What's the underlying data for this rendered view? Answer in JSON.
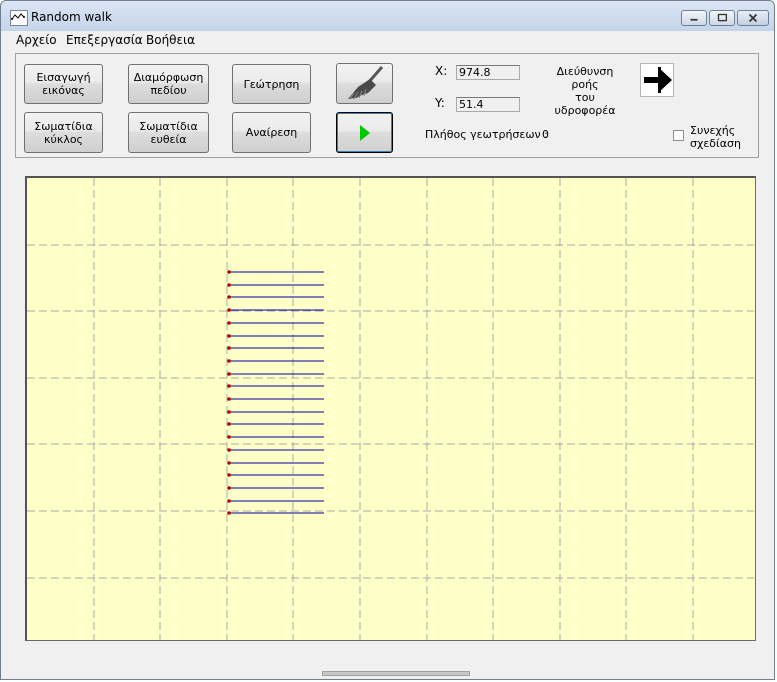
{
  "window": {
    "title": "Random walk",
    "icon": "random-walk-app-icon"
  },
  "menu": {
    "items": [
      "Αρχείο",
      "Επεξεργασία",
      "Βοήθεια"
    ]
  },
  "toolbar": {
    "insert_image": "Εισαγωγή\nεικόνας",
    "configure_field": "Διαμόρφωση\nπεδίου",
    "drilling": "Γεώτρηση",
    "particles_circle": "Σωματίδια\nκύκλος",
    "particles_line": "Σωματίδια\nευθεία",
    "remove": "Αναίρεση",
    "brush_icon": "broom-icon",
    "play_icon": "play-icon"
  },
  "coords": {
    "x_label": "X:",
    "x_value": "974.8",
    "y_label": "Y:",
    "y_value": "51.4"
  },
  "drill_count": {
    "label": "Πλήθος γεωτρήσεων :",
    "value": "0"
  },
  "flow_direction": {
    "label": "Διεύθυνση ροής\nτου υδροφορέα",
    "icon": "arrow-right-icon"
  },
  "continuous": {
    "label": "Συνεχής\nσχεδίαση",
    "checked": false
  },
  "colors": {
    "canvas_bg": "#ffffc8",
    "grid": "#a8a8a8",
    "line": "#0000a0",
    "dot": "#c00000",
    "play_green": "#00c800"
  },
  "canvas": {
    "grid_columns": 11,
    "grid_rows": 7,
    "particle_count": 20
  }
}
